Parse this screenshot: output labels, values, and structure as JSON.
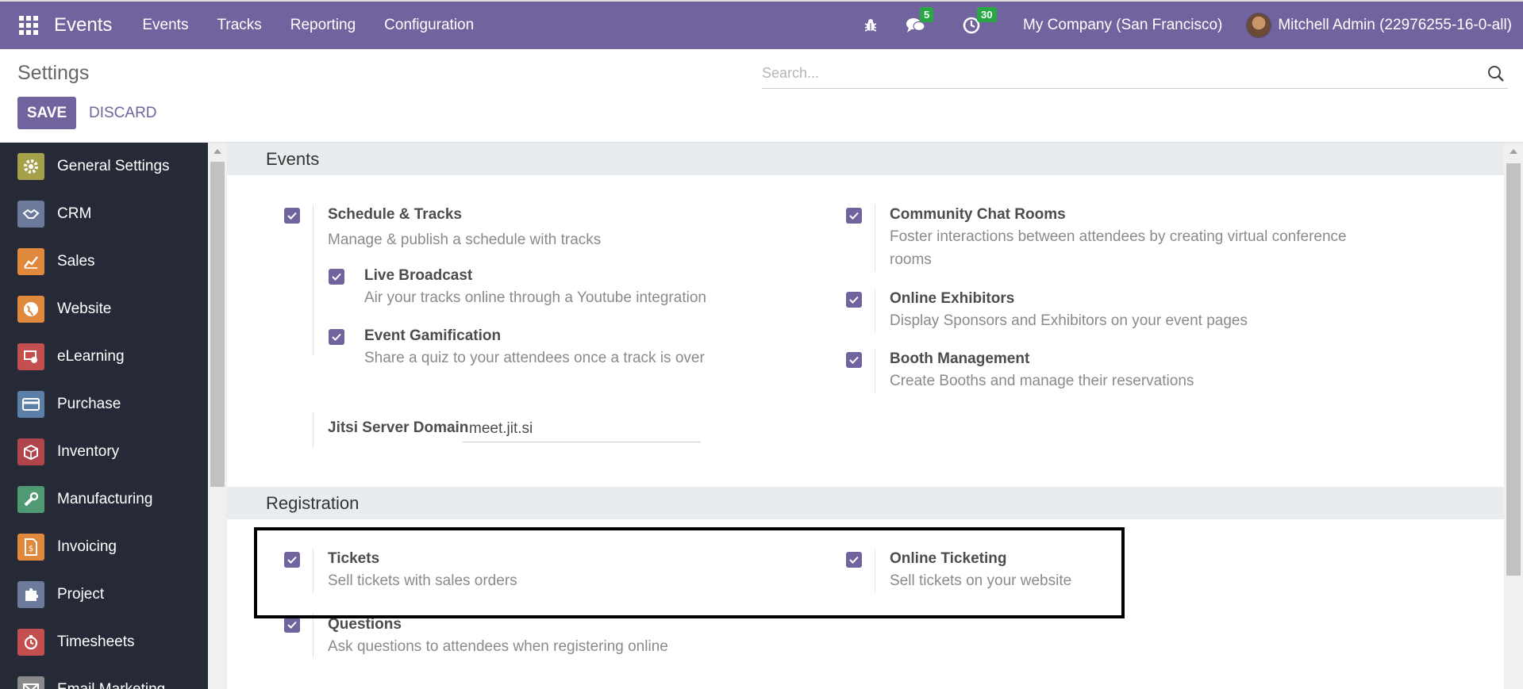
{
  "navbar": {
    "brand": "Events",
    "menu": [
      "Events",
      "Tracks",
      "Reporting",
      "Configuration"
    ],
    "messages_count": "5",
    "activities_count": "30",
    "company": "My Company (San Francisco)",
    "user": "Mitchell Admin (22976255-16-0-all)"
  },
  "control": {
    "title": "Settings",
    "search_placeholder": "Search...",
    "save_label": "SAVE",
    "discard_label": "DISCARD"
  },
  "sidebar": {
    "items": [
      {
        "label": "General Settings",
        "icon": "gear-icon",
        "color": "#a5a04a"
      },
      {
        "label": "CRM",
        "icon": "handshake-icon",
        "color": "#6c7a9c"
      },
      {
        "label": "Sales",
        "icon": "chart-line-icon",
        "color": "#e0883b"
      },
      {
        "label": "Website",
        "icon": "globe-icon",
        "color": "#e0883b"
      },
      {
        "label": "eLearning",
        "icon": "elearning-icon",
        "color": "#c44f4f"
      },
      {
        "label": "Purchase",
        "icon": "card-icon",
        "color": "#5c7fa8"
      },
      {
        "label": "Inventory",
        "icon": "box-icon",
        "color": "#b0464b"
      },
      {
        "label": "Manufacturing",
        "icon": "wrench-icon",
        "color": "#4f9a72"
      },
      {
        "label": "Invoicing",
        "icon": "invoice-icon",
        "color": "#e0883b"
      },
      {
        "label": "Project",
        "icon": "puzzle-icon",
        "color": "#6c7a9c"
      },
      {
        "label": "Timesheets",
        "icon": "timer-icon",
        "color": "#c44f4f"
      },
      {
        "label": "Email Marketing",
        "icon": "email-icon",
        "color": "#8a8a8a"
      }
    ]
  },
  "events_section": {
    "title": "Events",
    "schedule": {
      "title": "Schedule & Tracks",
      "desc": "Manage & publish a schedule with tracks"
    },
    "live_broadcast": {
      "title": "Live Broadcast",
      "desc": "Air your tracks online through a Youtube integration"
    },
    "gamification": {
      "title": "Event Gamification",
      "desc": "Share a quiz to your attendees once a track is over"
    },
    "jitsi": {
      "label": "Jitsi Server Domain",
      "value": "meet.jit.si"
    },
    "chat_rooms": {
      "title": "Community Chat Rooms",
      "desc": "Foster interactions between attendees by creating virtual conference rooms"
    },
    "exhibitors": {
      "title": "Online Exhibitors",
      "desc": "Display Sponsors and Exhibitors on your event pages"
    },
    "booth": {
      "title": "Booth Management",
      "desc": "Create Booths and manage their reservations"
    }
  },
  "registration_section": {
    "title": "Registration",
    "tickets": {
      "title": "Tickets",
      "desc": "Sell tickets with sales orders"
    },
    "online_ticketing": {
      "title": "Online Ticketing",
      "desc": "Sell tickets on your website"
    },
    "questions": {
      "title": "Questions",
      "desc": "Ask questions to attendees when registering online"
    }
  }
}
